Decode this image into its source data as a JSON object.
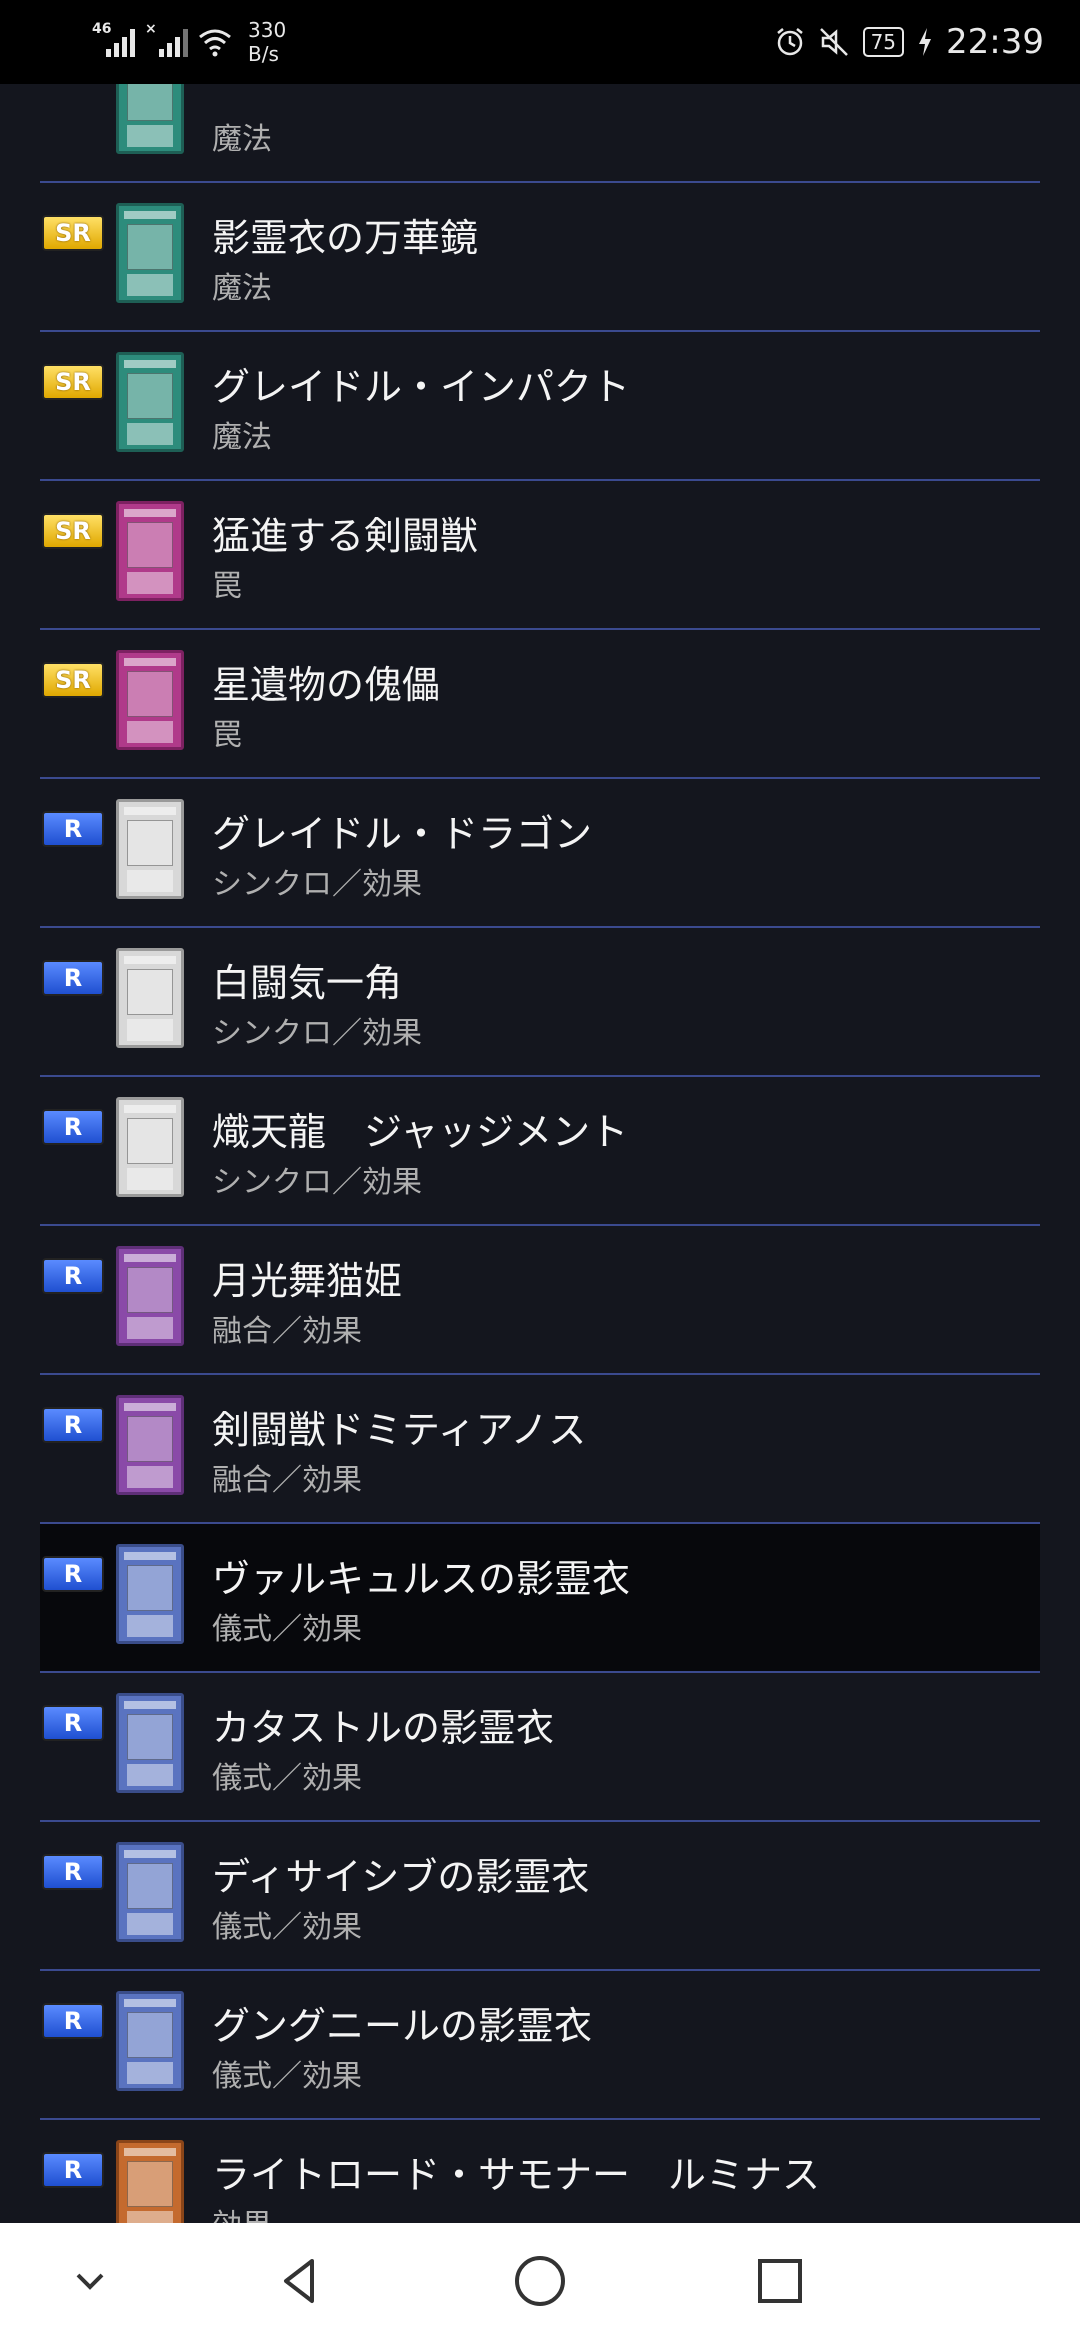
{
  "status_bar": {
    "signal1_tag": "46",
    "signal2_tag": "×",
    "net_speed_value": "330",
    "net_speed_unit": "B/s",
    "battery": "75",
    "time": "22:39"
  },
  "partial_top_row": {
    "type": "魔法",
    "card_color": "spell"
  },
  "rows": [
    {
      "rarity": "SR",
      "name": "影霊衣の万華鏡",
      "type": "魔法",
      "card_color": "spell"
    },
    {
      "rarity": "SR",
      "name": "グレイドル・インパクト",
      "type": "魔法",
      "card_color": "spell"
    },
    {
      "rarity": "SR",
      "name": "猛進する剣闘獣",
      "type": "罠",
      "card_color": "trap"
    },
    {
      "rarity": "SR",
      "name": "星遺物の傀儡",
      "type": "罠",
      "card_color": "trap"
    },
    {
      "rarity": "R",
      "name": "グレイドル・ドラゴン",
      "type": "シンクロ／効果",
      "card_color": "synchro"
    },
    {
      "rarity": "R",
      "name": "白闘気一角",
      "type": "シンクロ／効果",
      "card_color": "synchro"
    },
    {
      "rarity": "R",
      "name": "熾天龍　ジャッジメント",
      "type": "シンクロ／効果",
      "card_color": "synchro"
    },
    {
      "rarity": "R",
      "name": "月光舞猫姫",
      "type": "融合／効果",
      "card_color": "fusion"
    },
    {
      "rarity": "R",
      "name": "剣闘獣ドミティアノス",
      "type": "融合／効果",
      "card_color": "fusion"
    },
    {
      "rarity": "R",
      "name": "ヴァルキュルスの影霊衣",
      "type": "儀式／効果",
      "card_color": "ritual",
      "selected": true
    },
    {
      "rarity": "R",
      "name": "カタストルの影霊衣",
      "type": "儀式／効果",
      "card_color": "ritual"
    },
    {
      "rarity": "R",
      "name": "ディサイシブの影霊衣",
      "type": "儀式／効果",
      "card_color": "ritual"
    },
    {
      "rarity": "R",
      "name": "グングニールの影霊衣",
      "type": "儀式／効果",
      "card_color": "ritual"
    },
    {
      "rarity": "R",
      "name": "ライトロード・サモナー　ルミナス",
      "type": "効果",
      "card_color": "effect"
    }
  ],
  "nav_bar": {
    "icons": [
      "chevron-down-icon",
      "back-triangle-icon",
      "home-circle-icon",
      "recents-square-icon"
    ]
  }
}
